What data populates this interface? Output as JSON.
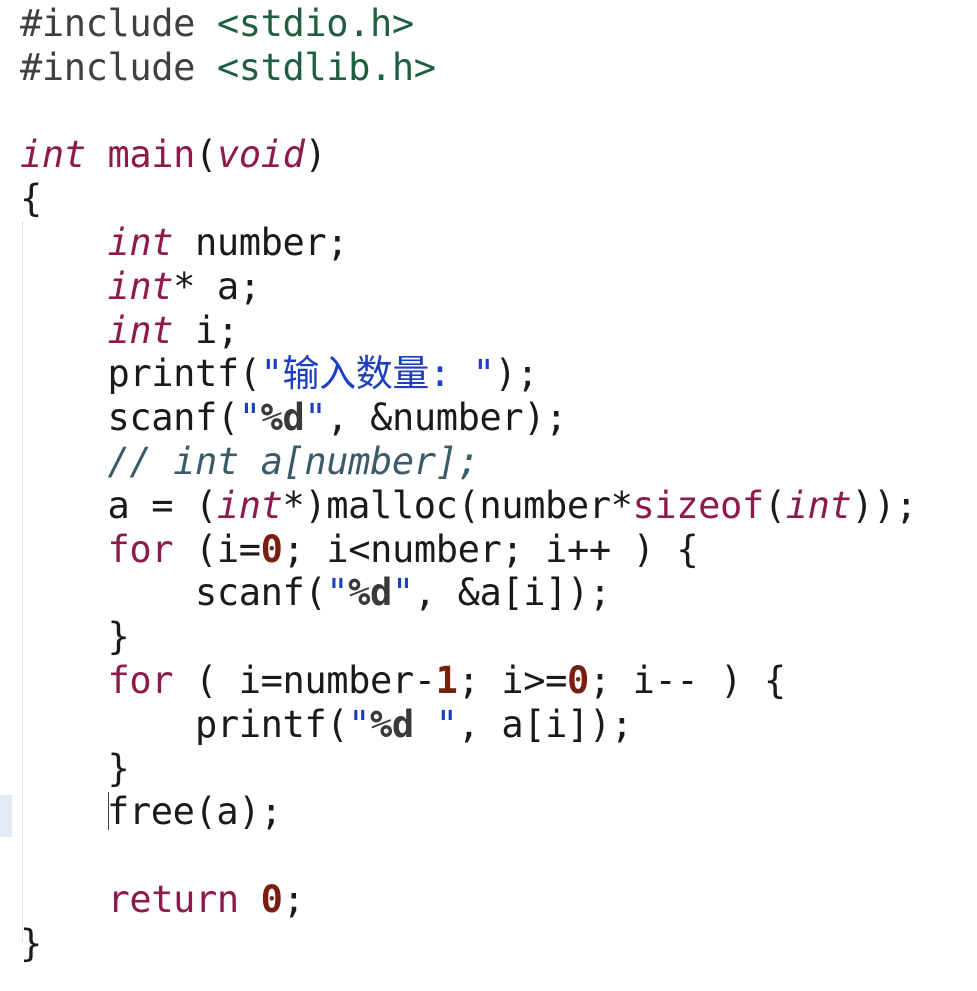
{
  "editor": {
    "lines": [
      {
        "id": "l1",
        "parts": [
          [
            "pp",
            "#include "
          ],
          [
            "inc",
            "<stdio.h>"
          ]
        ]
      },
      {
        "id": "l2",
        "parts": [
          [
            "pp",
            "#include "
          ],
          [
            "inc",
            "<stdlib.h>"
          ]
        ]
      },
      {
        "id": "l3",
        "parts": []
      },
      {
        "id": "l4",
        "parts": [
          [
            "ty",
            "int"
          ],
          [
            "fn",
            " "
          ],
          [
            "kw",
            "main"
          ],
          [
            "fn",
            "("
          ],
          [
            "ty",
            "void"
          ],
          [
            "fn",
            ")"
          ]
        ]
      },
      {
        "id": "l5",
        "parts": [
          [
            "fn",
            "{"
          ]
        ]
      },
      {
        "id": "l6",
        "parts": [
          [
            "fn",
            "    "
          ],
          [
            "ty",
            "int"
          ],
          [
            "fn",
            " number;"
          ]
        ]
      },
      {
        "id": "l7",
        "parts": [
          [
            "fn",
            "    "
          ],
          [
            "ty",
            "int"
          ],
          [
            "fn",
            "* a;"
          ]
        ]
      },
      {
        "id": "l8",
        "parts": [
          [
            "fn",
            "    "
          ],
          [
            "ty",
            "int"
          ],
          [
            "fn",
            " i;"
          ]
        ]
      },
      {
        "id": "l9",
        "parts": [
          [
            "fn",
            "    printf("
          ],
          [
            "str",
            "\"输入数量: \""
          ],
          [
            "fn",
            ");"
          ]
        ]
      },
      {
        "id": "l10",
        "parts": [
          [
            "fn",
            "    scanf("
          ],
          [
            "str",
            "\""
          ],
          [
            "fmt",
            "%d"
          ],
          [
            "str",
            "\""
          ],
          [
            "fn",
            ", &number);"
          ]
        ]
      },
      {
        "id": "l11",
        "parts": [
          [
            "fn",
            "    "
          ],
          [
            "cmt",
            "// int a[number];"
          ]
        ]
      },
      {
        "id": "l12",
        "parts": [
          [
            "fn",
            "    a = ("
          ],
          [
            "ty",
            "int"
          ],
          [
            "fn",
            "*)malloc(number*"
          ],
          [
            "kw",
            "sizeof"
          ],
          [
            "fn",
            "("
          ],
          [
            "ty",
            "int"
          ],
          [
            "fn",
            "));"
          ]
        ]
      },
      {
        "id": "l13",
        "parts": [
          [
            "fn",
            "    "
          ],
          [
            "kw",
            "for"
          ],
          [
            "fn",
            " (i="
          ],
          [
            "num",
            "0"
          ],
          [
            "fn",
            "; i<number; i++ ) {"
          ]
        ]
      },
      {
        "id": "l14",
        "parts": [
          [
            "fn",
            "        scanf("
          ],
          [
            "str",
            "\""
          ],
          [
            "fmt",
            "%d"
          ],
          [
            "str",
            "\""
          ],
          [
            "fn",
            ", &a[i]);"
          ]
        ]
      },
      {
        "id": "l15",
        "parts": [
          [
            "fn",
            "    }"
          ]
        ]
      },
      {
        "id": "l16",
        "parts": [
          [
            "fn",
            "    "
          ],
          [
            "kw",
            "for"
          ],
          [
            "fn",
            " ( i=number-"
          ],
          [
            "num",
            "1"
          ],
          [
            "fn",
            "; i>="
          ],
          [
            "num",
            "0"
          ],
          [
            "fn",
            "; i-- ) {"
          ]
        ]
      },
      {
        "id": "l17",
        "parts": [
          [
            "fn",
            "        printf("
          ],
          [
            "str",
            "\""
          ],
          [
            "fmt",
            "%d"
          ],
          [
            "str",
            " \""
          ],
          [
            "fn",
            ", a[i]);"
          ]
        ]
      },
      {
        "id": "l18",
        "parts": [
          [
            "fn",
            "    }"
          ]
        ]
      },
      {
        "id": "l19",
        "parts": [
          [
            "fn",
            "    "
          ],
          [
            "caret",
            ""
          ],
          [
            "fn",
            "free(a);"
          ]
        ]
      },
      {
        "id": "l20",
        "parts": []
      },
      {
        "id": "l21",
        "parts": [
          [
            "fn",
            "    "
          ],
          [
            "kw",
            "return"
          ],
          [
            "fn",
            " "
          ],
          [
            "num",
            "0"
          ],
          [
            "fn",
            ";"
          ]
        ]
      },
      {
        "id": "l22",
        "parts": [
          [
            "fn",
            "}"
          ]
        ]
      }
    ]
  }
}
